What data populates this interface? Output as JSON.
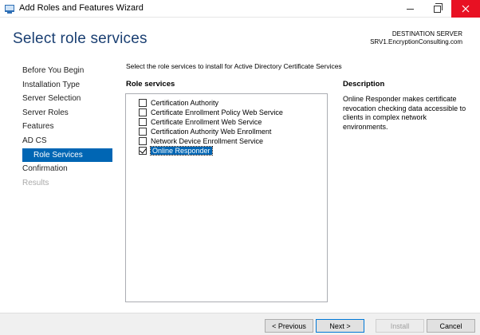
{
  "window": {
    "title": "Add Roles and Features Wizard",
    "close_color": "#e81123",
    "icons": {
      "app": "server-manager-icon",
      "minimize": "minimize-icon",
      "maximize": "restore-icon",
      "close": "close-icon"
    }
  },
  "header": {
    "title": "Select role services",
    "destination_label": "DESTINATION SERVER",
    "destination_server": "SRV1.EncryptionConsulting.com"
  },
  "nav": {
    "items": [
      {
        "label": "Before You Begin",
        "state": "normal"
      },
      {
        "label": "Installation Type",
        "state": "normal"
      },
      {
        "label": "Server Selection",
        "state": "normal"
      },
      {
        "label": "Server Roles",
        "state": "normal"
      },
      {
        "label": "Features",
        "state": "normal"
      },
      {
        "label": "AD CS",
        "state": "normal"
      },
      {
        "label": "Role Services",
        "state": "active"
      },
      {
        "label": "Confirmation",
        "state": "normal"
      },
      {
        "label": "Results",
        "state": "disabled"
      }
    ],
    "accent_color": "#0066b4"
  },
  "main": {
    "instructions": "Select the role services to install for Active Directory Certificate Services",
    "role_services_header": "Role services",
    "role_services": [
      {
        "label": "Certification Authority",
        "checked": false,
        "selected": false
      },
      {
        "label": "Certificate Enrollment Policy Web Service",
        "checked": false,
        "selected": false
      },
      {
        "label": "Certificate Enrollment Web Service",
        "checked": false,
        "selected": false
      },
      {
        "label": "Certification Authority Web Enrollment",
        "checked": false,
        "selected": false
      },
      {
        "label": "Network Device Enrollment Service",
        "checked": false,
        "selected": false
      },
      {
        "label": "Online Responder",
        "checked": true,
        "selected": true
      }
    ],
    "description_header": "Description",
    "description_text": "Online Responder makes certificate revocation checking data accessible to clients in complex network environments."
  },
  "footer": {
    "previous_label": "< Previous",
    "next_label": "Next >",
    "install_label": "Install",
    "cancel_label": "Cancel"
  }
}
